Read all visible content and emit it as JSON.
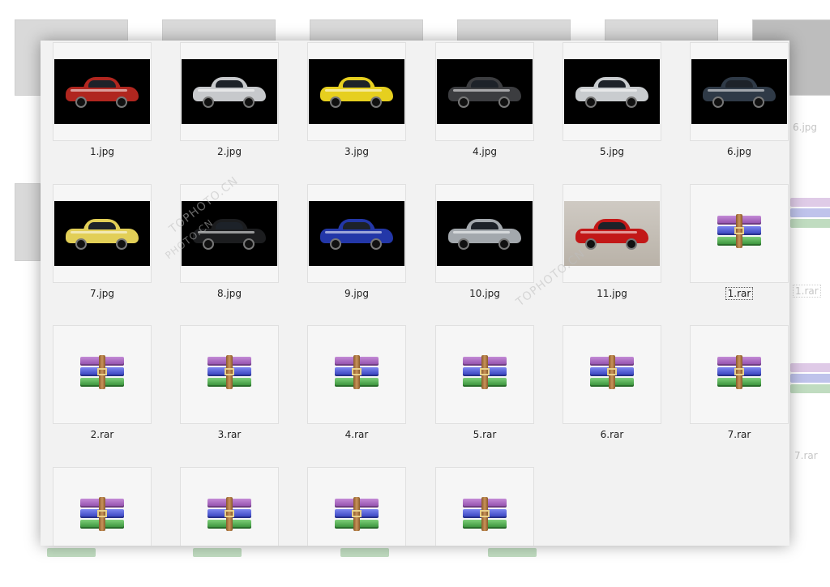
{
  "files": [
    {
      "name": "1.jpg",
      "kind": "image",
      "car_color": "#b0261f",
      "bg": "dark"
    },
    {
      "name": "2.jpg",
      "kind": "image",
      "car_color": "#c7c9cc",
      "bg": "dark"
    },
    {
      "name": "3.jpg",
      "kind": "image",
      "car_color": "#e6cf1f",
      "bg": "dark"
    },
    {
      "name": "4.jpg",
      "kind": "image",
      "car_color": "#3c3d40",
      "bg": "dark"
    },
    {
      "name": "5.jpg",
      "kind": "image",
      "car_color": "#c9cccf",
      "bg": "dark"
    },
    {
      "name": "6.jpg",
      "kind": "image",
      "car_color": "#2f3a47",
      "bg": "dark"
    },
    {
      "name": "7.jpg",
      "kind": "image",
      "car_color": "#e2cf57",
      "bg": "dark"
    },
    {
      "name": "8.jpg",
      "kind": "image",
      "car_color": "#1c1d1f",
      "bg": "dark"
    },
    {
      "name": "9.jpg",
      "kind": "image",
      "car_color": "#2337a8",
      "bg": "dark"
    },
    {
      "name": "10.jpg",
      "kind": "image",
      "car_color": "#a3a8ad",
      "bg": "dark"
    },
    {
      "name": "11.jpg",
      "kind": "image",
      "car_color": "#c21818",
      "bg": "light"
    },
    {
      "name": "1.rar",
      "kind": "archive",
      "selected": true
    },
    {
      "name": "2.rar",
      "kind": "archive"
    },
    {
      "name": "3.rar",
      "kind": "archive"
    },
    {
      "name": "4.rar",
      "kind": "archive"
    },
    {
      "name": "5.rar",
      "kind": "archive"
    },
    {
      "name": "6.rar",
      "kind": "archive"
    },
    {
      "name": "7.rar",
      "kind": "archive"
    },
    {
      "name": "",
      "kind": "archive"
    },
    {
      "name": "",
      "kind": "archive"
    },
    {
      "name": "",
      "kind": "archive"
    },
    {
      "name": "",
      "kind": "archive"
    }
  ],
  "background": {
    "labels": [
      "6.jpg",
      "1.rar",
      "7.rar"
    ]
  },
  "watermark": {
    "text_1": "TOPHOTO.CN",
    "text_2": "TOPHOTO.CN",
    "text_3": "PHOTO.CN"
  },
  "icons": {
    "archive": "winrar-archive-icon",
    "image": "car-photo-thumbnail"
  },
  "colors": {
    "panel_bg": "#f2f2f2",
    "tile_border": "#e0e0e0"
  }
}
